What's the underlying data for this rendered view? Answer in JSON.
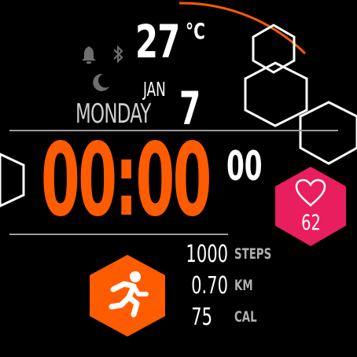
{
  "weather": {
    "temperature": "27",
    "unit": "°C"
  },
  "date": {
    "month": "JAN",
    "day": "7",
    "weekday": "MONDAY"
  },
  "time": {
    "hours_minutes": "00:00",
    "seconds": "00"
  },
  "health": {
    "heart_rate": "62"
  },
  "activity": {
    "steps": {
      "value": "1000",
      "label": "STEPS"
    },
    "distance": {
      "value": "0.70",
      "label": "KM"
    },
    "calories": {
      "value": "75",
      "label": "CAL"
    }
  },
  "icons": [
    "bell-icon",
    "bluetooth-icon",
    "moon-icon",
    "heart-icon",
    "running-icon"
  ],
  "colors": {
    "accent": "#ff5b00",
    "heart_bg": "#e91e5f",
    "background": "#000000"
  }
}
